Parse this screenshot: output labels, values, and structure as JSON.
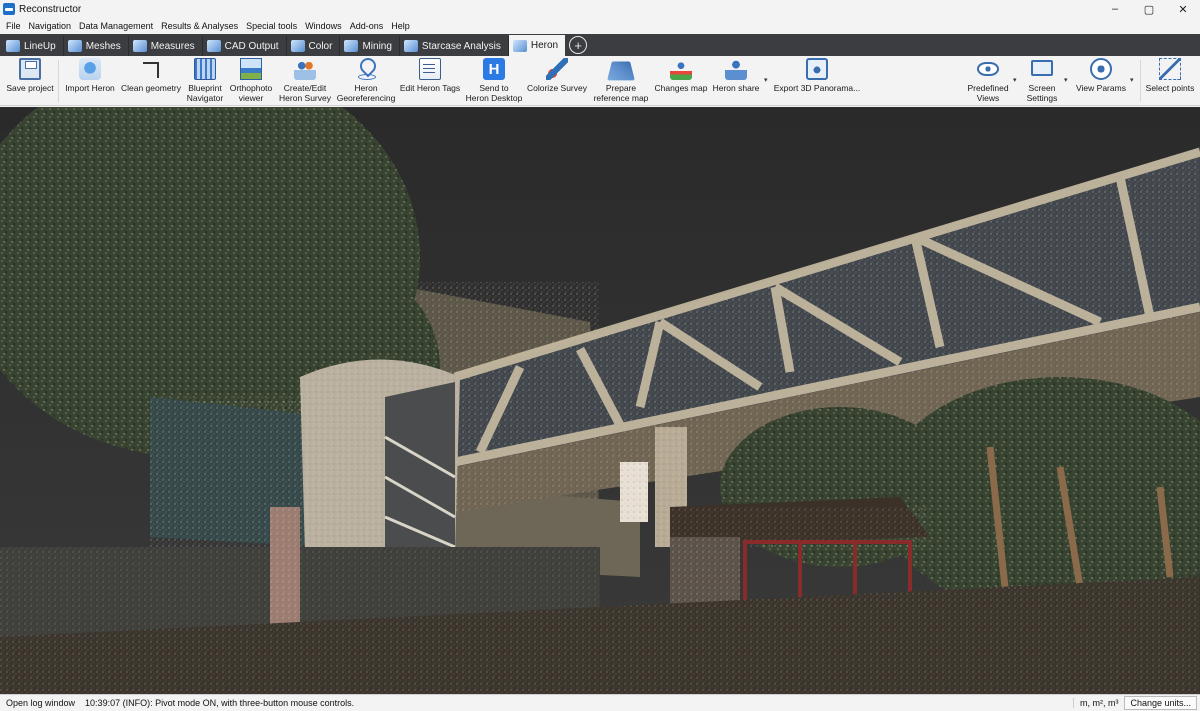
{
  "window": {
    "title": "Reconstructor",
    "controls": [
      "–",
      "▢",
      "✕"
    ]
  },
  "menu": [
    "File",
    "Navigation",
    "Data Management",
    "Results & Analyses",
    "Special tools",
    "Windows",
    "Add-ons",
    "Help"
  ],
  "tabs": [
    {
      "label": "LineUp",
      "icon": "lineup-icon",
      "active": false
    },
    {
      "label": "Meshes",
      "icon": "meshes-icon",
      "active": false
    },
    {
      "label": "Measures",
      "icon": "measures-icon",
      "active": false
    },
    {
      "label": "CAD Output",
      "icon": "cad-icon",
      "active": false
    },
    {
      "label": "Color",
      "icon": "color-icon",
      "active": false
    },
    {
      "label": "Mining",
      "icon": "mining-icon",
      "active": false
    },
    {
      "label": "Starcase Analysis",
      "icon": "staircase-icon",
      "active": false
    },
    {
      "label": "Heron",
      "icon": "heron-icon",
      "active": true
    }
  ],
  "add_tab": "+",
  "ribbon": {
    "save_project": "Save project",
    "import_heron": "Import Heron",
    "clean_geometry": "Clean geometry",
    "blueprint_navigator": [
      "Blueprint",
      "Navigator"
    ],
    "orthophoto_viewer": [
      "Orthophoto",
      "viewer"
    ],
    "create_edit_heron_survey": [
      "Create/Edit",
      "Heron Survey"
    ],
    "heron_georeferencing": [
      "Heron",
      "Georeferencing"
    ],
    "edit_heron_tags": "Edit Heron Tags",
    "send_to_heron_desktop": [
      "Send to",
      "Heron Desktop"
    ],
    "colorize_survey": "Colorize Survey",
    "prepare_reference_map": [
      "Prepare",
      "reference map"
    ],
    "changes_map": "Changes map",
    "heron_share": "Heron share",
    "export_3d_panorama": "Export 3D Panorama...",
    "predefined_views": [
      "Predefined",
      "Views"
    ],
    "screen_settings": [
      "Screen",
      "Settings"
    ],
    "view_params": "View Params",
    "select_points": "Select points",
    "dropdown_glyph": "▾"
  },
  "status": {
    "open_log": "Open log window",
    "message": "10:39:07 (INFO): Pivot mode ON, with three-button mouse controls.",
    "units": "m, m², m³",
    "change_units": "Change units..."
  },
  "viewport": {
    "description_colors": {
      "sky": "#2e2e2e",
      "foliage": "#3d4a36",
      "bridge": "#b8aa92",
      "ground": "#3a342c"
    }
  }
}
